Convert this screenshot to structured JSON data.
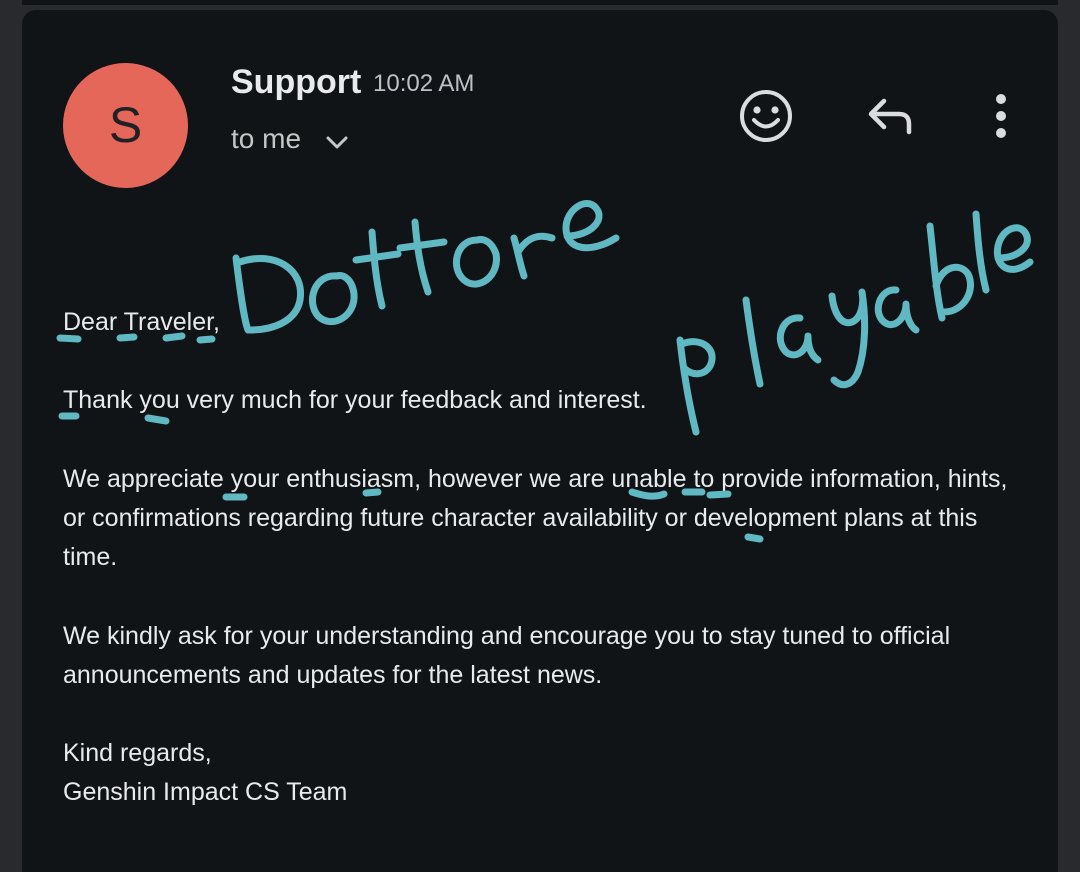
{
  "email": {
    "avatar_letter": "S",
    "avatar_color": "#e5675a",
    "sender": "Support",
    "time": "10:02 AM",
    "recipient": "to me",
    "actions": {
      "emoji": "smiley-icon",
      "reply": "reply-icon",
      "more": "more-vert-icon",
      "expand": "chevron-down-icon"
    },
    "greeting": "Dear Traveler,",
    "paragraphs": [
      "Thank you very much for your feedback and interest.",
      "We appreciate your enthusiasm, however we are unable to provide information, hints, or confirmations regarding future character availability or development plans at this time.",
      "We kindly ask for your understanding and encourage you to stay tuned to official announcements and updates for the latest news."
    ],
    "signoff": "Kind regards,",
    "signature": "Genshin Impact CS Team"
  },
  "annotation": {
    "text_1": "Dottore",
    "text_2": "playable",
    "ink_color": "#5fb8c2"
  }
}
